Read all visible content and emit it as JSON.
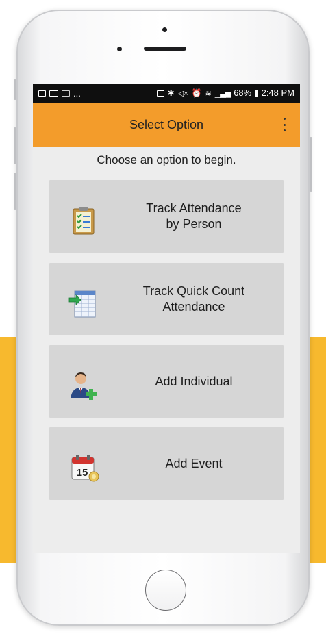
{
  "status_bar": {
    "right_text": "68% ▮ 2:48 PM",
    "left_text": "..."
  },
  "app_bar": {
    "title": "Select Option"
  },
  "prompt": "Choose an option to begin.",
  "options": [
    {
      "label": "Track Attendance\nby Person",
      "icon": "clipboard-checklist-icon"
    },
    {
      "label": "Track Quick Count\nAttendance",
      "icon": "spreadsheet-icon"
    },
    {
      "label": "Add Individual",
      "icon": "add-person-icon"
    },
    {
      "label": "Add Event",
      "icon": "calendar-icon"
    }
  ],
  "calendar_day": "15",
  "colors": {
    "accent": "#f39c2b",
    "band": "#f7b92e",
    "button": "#d6d6d6"
  }
}
